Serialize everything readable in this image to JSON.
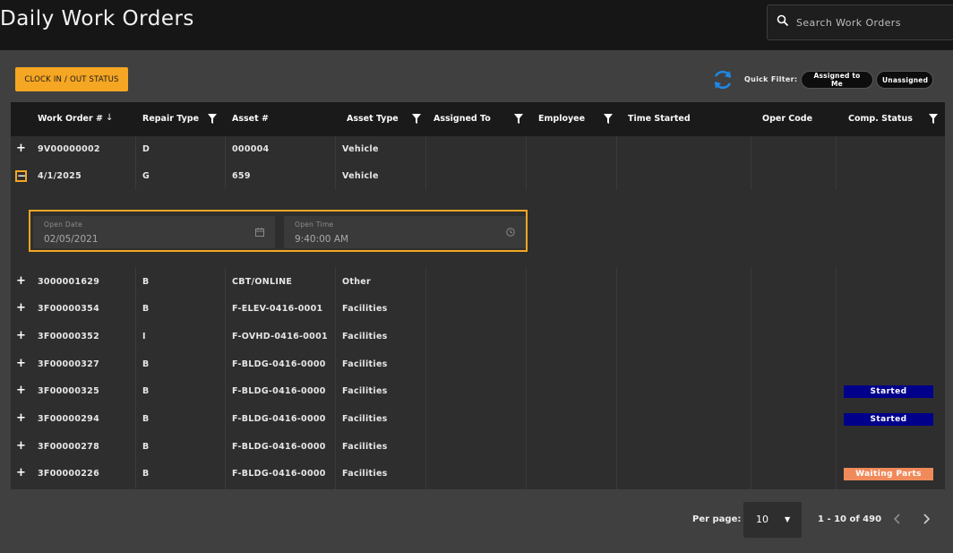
{
  "header": {
    "title": "Daily Work Orders",
    "search_placeholder": "Search Work Orders"
  },
  "toolbar": {
    "clock_button_label": "CLOCK IN / OUT STATUS",
    "quick_filter_label": "Quick Filter:",
    "chip_assigned_to_me": "Assigned to Me",
    "chip_unassigned": "Unassigned"
  },
  "table": {
    "columns": {
      "work_order": "Work Order #",
      "repair_type": "Repair Type",
      "asset": "Asset #",
      "asset_type": "Asset Type",
      "assigned_to": "Assigned To",
      "employee": "Employee",
      "time_started": "Time Started",
      "oper_code": "Oper Code",
      "comp_status": "Comp. Status"
    },
    "rows": [
      {
        "expander": "+",
        "work_order": "9V00000002",
        "repair_type": "D",
        "asset": "000004",
        "asset_type": "Vehicle",
        "status": ""
      },
      {
        "expander": "−",
        "work_order": "4/1/2025",
        "repair_type": "G",
        "asset": "659",
        "asset_type": "Vehicle",
        "status": ""
      },
      {
        "expander": "+",
        "work_order": "3000001629",
        "repair_type": "B",
        "asset": "CBT/ONLINE",
        "asset_type": "Other",
        "status": ""
      },
      {
        "expander": "+",
        "work_order": "3F00000354",
        "repair_type": "B",
        "asset": "F-ELEV-0416-0001",
        "asset_type": "Facilities",
        "status": ""
      },
      {
        "expander": "+",
        "work_order": "3F00000352",
        "repair_type": "I",
        "asset": "F-OVHD-0416-0001",
        "asset_type": "Facilities",
        "status": ""
      },
      {
        "expander": "+",
        "work_order": "3F00000327",
        "repair_type": "B",
        "asset": "F-BLDG-0416-0000",
        "asset_type": "Facilities",
        "status": ""
      },
      {
        "expander": "+",
        "work_order": "3F00000325",
        "repair_type": "B",
        "asset": "F-BLDG-0416-0000",
        "asset_type": "Facilities",
        "status": "Started"
      },
      {
        "expander": "+",
        "work_order": "3F00000294",
        "repair_type": "B",
        "asset": "F-BLDG-0416-0000",
        "asset_type": "Facilities",
        "status": "Started"
      },
      {
        "expander": "+",
        "work_order": "3F00000278",
        "repair_type": "B",
        "asset": "F-BLDG-0416-0000",
        "asset_type": "Facilities",
        "status": ""
      },
      {
        "expander": "+",
        "work_order": "3F00000226",
        "repair_type": "B",
        "asset": "F-BLDG-0416-0000",
        "asset_type": "Facilities",
        "status": "Waiting Parts"
      }
    ],
    "detail": {
      "open_date_label": "Open Date",
      "open_date_value": "02/05/2021",
      "open_time_label": "Open Time",
      "open_time_value": "9:40:00 AM"
    }
  },
  "pagination": {
    "per_page_label": "Per page:",
    "per_page_value": "10",
    "range_text": "1 - 10 of 490"
  },
  "colors": {
    "accent": "#f5a623",
    "started": "#00008b",
    "waiting_parts": "#f08a5a"
  }
}
